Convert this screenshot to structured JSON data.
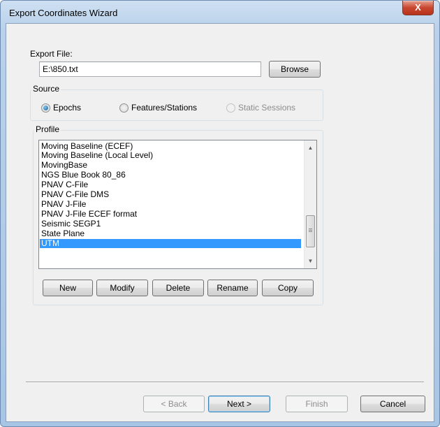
{
  "window": {
    "title": "Export Coordinates Wizard",
    "close_glyph": "X"
  },
  "export_file": {
    "label": "Export File:",
    "value": "E:\\850.txt",
    "browse_label": "Browse"
  },
  "source": {
    "title": "Source",
    "options": [
      {
        "label": "Epochs",
        "selected": true,
        "enabled": true
      },
      {
        "label": "Features/Stations",
        "selected": false,
        "enabled": true
      },
      {
        "label": "Static Sessions",
        "selected": false,
        "enabled": false
      }
    ]
  },
  "profile": {
    "title": "Profile",
    "items": [
      "Moving Baseline (ECEF)",
      "Moving Baseline (Local Level)",
      "MovingBase",
      "NGS Blue Book 80_86",
      "PNAV C-File",
      "PNAV C-File DMS",
      "PNAV J-File",
      "PNAV J-File ECEF format",
      "Seismic SEGP1",
      "State Plane",
      "UTM"
    ],
    "selected_index": 10,
    "buttons": {
      "new": "New",
      "modify": "Modify",
      "delete": "Delete",
      "rename": "Rename",
      "copy": "Copy"
    }
  },
  "nav": {
    "back": "< Back",
    "next": "Next >",
    "finish": "Finish",
    "cancel": "Cancel"
  },
  "colors": {
    "selection": "#3399ff",
    "close": "#c8462f"
  }
}
